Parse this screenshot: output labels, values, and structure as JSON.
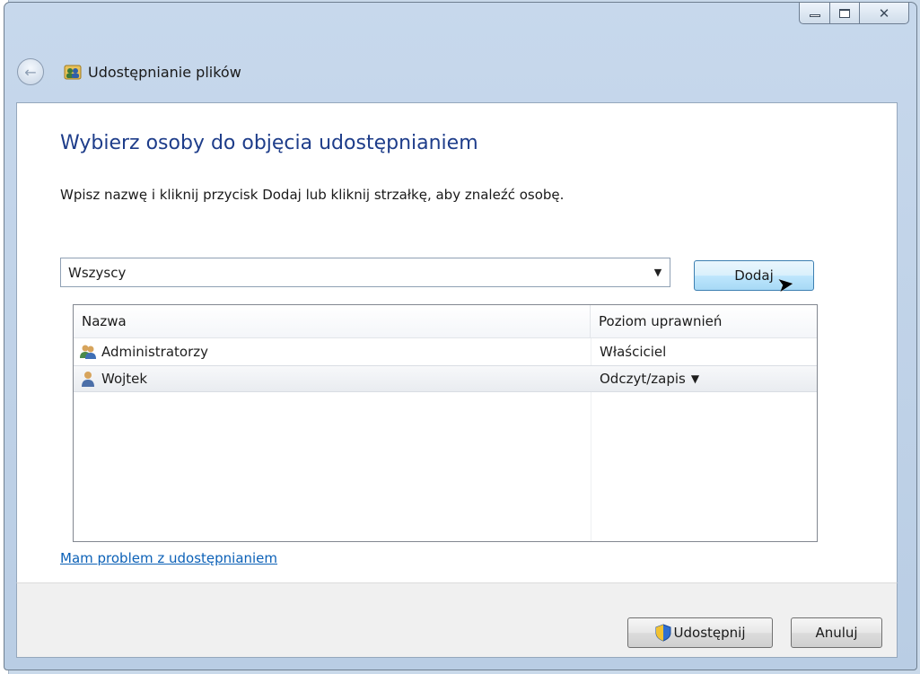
{
  "window": {
    "title": "Udostępnianie plików",
    "controls": {
      "minimize": "minimize",
      "maximize": "maximize",
      "close": "close"
    }
  },
  "content": {
    "heading": "Wybierz osoby do objęcia udostępnianiem",
    "instruction": "Wpisz nazwę i kliknij przycisk Dodaj lub kliknij strzałkę, aby znaleźć osobę.",
    "combo": {
      "value": "Wszyscy"
    },
    "add_button": "Dodaj",
    "list": {
      "columns": [
        "Nazwa",
        "Poziom uprawnień"
      ],
      "rows": [
        {
          "name": "Administratorzy",
          "permission": "Właściciel",
          "icon": "group-icon"
        },
        {
          "name": "Wojtek",
          "permission": "Odczyt/zapis",
          "icon": "user-icon",
          "selected": true
        }
      ]
    },
    "help_link": "Mam problem z udostępnianiem"
  },
  "footer": {
    "share_button": "Udostępnij",
    "cancel_button": "Anuluj"
  },
  "colors": {
    "heading": "#1e3d8a",
    "link": "#0c61b7",
    "frame": "#c7d8ec"
  }
}
